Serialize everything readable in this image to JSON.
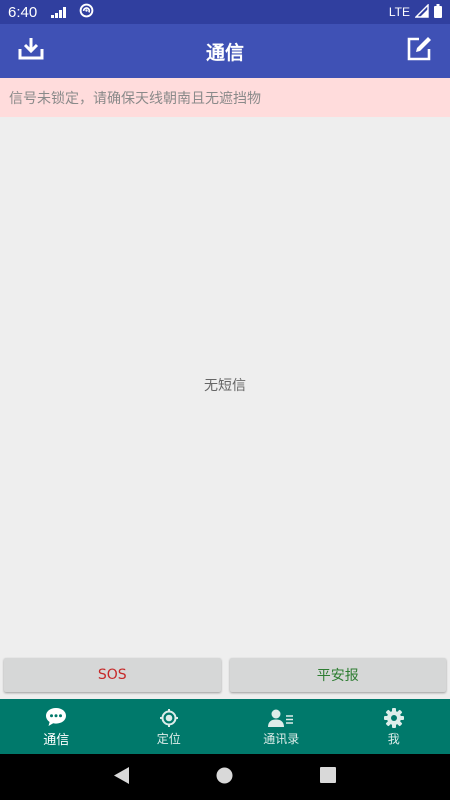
{
  "status_bar": {
    "time": "6:40",
    "network": "LTE"
  },
  "app_bar": {
    "title": "通信"
  },
  "warning": {
    "text": "信号未锁定，请确保天线朝南且无遮挡物"
  },
  "content": {
    "empty_text": "无短信"
  },
  "actions": {
    "sos_label": "SOS",
    "safe_label": "平安报"
  },
  "bottom_nav": {
    "items": [
      {
        "label": "通信",
        "icon": "chat-icon",
        "active": true
      },
      {
        "label": "定位",
        "icon": "location-icon",
        "active": false
      },
      {
        "label": "通讯录",
        "icon": "contacts-icon",
        "active": false
      },
      {
        "label": "我",
        "icon": "gear-icon",
        "active": false
      }
    ]
  },
  "colors": {
    "status_bar": "#303F9F",
    "app_bar": "#3F51B5",
    "warning_bg": "#FFDCDC",
    "bottom_nav": "#00796B",
    "sos": "#C62828",
    "safe": "#2E7D32"
  }
}
